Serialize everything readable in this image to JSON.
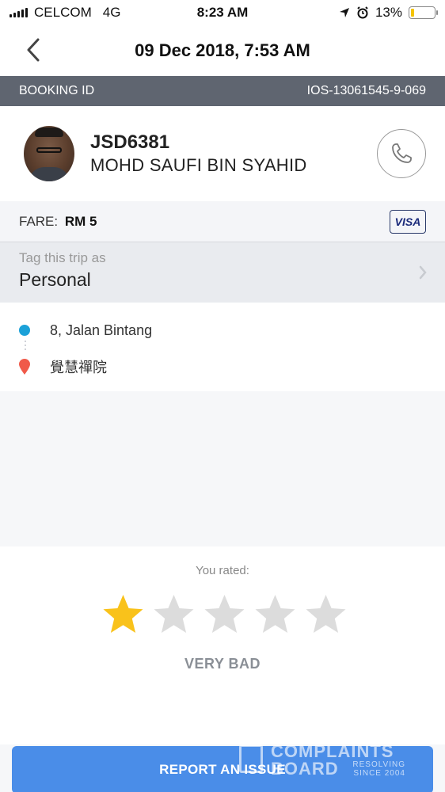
{
  "status_bar": {
    "carrier": "CELCOM",
    "network": "4G",
    "time": "8:23 AM",
    "battery_percent": "13%",
    "battery_level": 0.13,
    "battery_color": "#f5c400"
  },
  "nav": {
    "title": "09 Dec 2018, 7:53 AM",
    "back_icon": "chevron-left-icon"
  },
  "booking": {
    "label": "BOOKING ID",
    "id": "IOS-13061545-9-069"
  },
  "driver": {
    "plate": "JSD6381",
    "name": "MOHD SAUFI BIN SYAHID",
    "call_icon": "phone-icon"
  },
  "fare": {
    "label": "FARE:",
    "amount": "RM 5",
    "payment_method": "VISA"
  },
  "tag_trip": {
    "label": "Tag this trip as",
    "value": "Personal"
  },
  "route": {
    "pickup": "8, Jalan Bintang",
    "dropoff": "覺慧禪院",
    "pickup_color": "#1ba1d8",
    "dropoff_color": "#f05a4a"
  },
  "rating": {
    "label": "You rated:",
    "stars_total": 5,
    "stars_selected": 1,
    "text": "VERY BAD",
    "active_color": "#f9c21b",
    "inactive_color": "#dcdcdc"
  },
  "report": {
    "label": "REPORT AN ISSUE",
    "color": "#4a8de8"
  },
  "watermark": {
    "line1": "COMPLAINTS",
    "line2": "BOARD",
    "tagline1": "RESOLVING",
    "tagline2": "SINCE 2004"
  }
}
